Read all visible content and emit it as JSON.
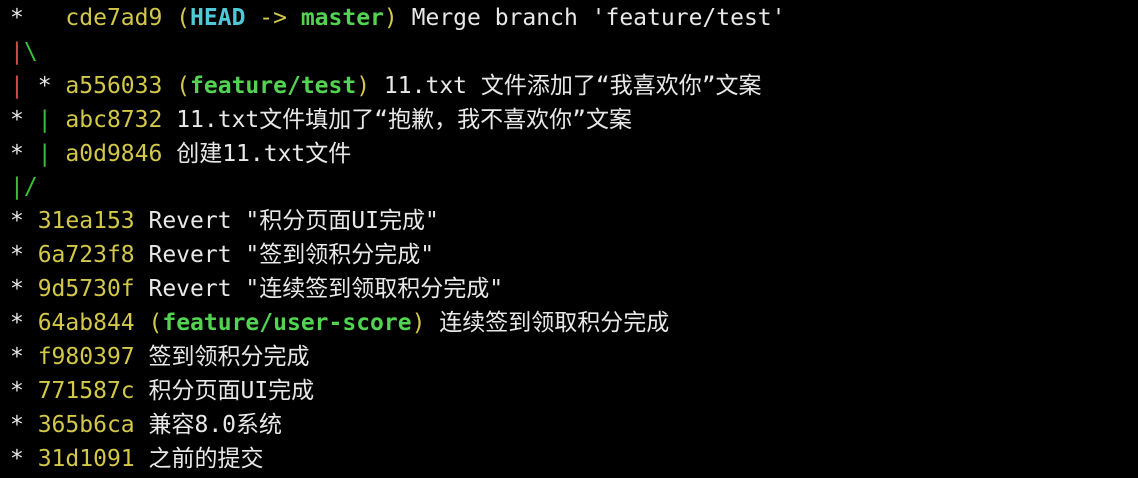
{
  "terminal": {
    "line_count": 14
  },
  "log": {
    "line0": {
      "star": "*",
      "pad": "   ",
      "hash": "cde7ad9",
      "open": " (",
      "head": "HEAD",
      "arrow": " -> ",
      "branch": "master",
      "close": ")",
      "message": " Merge branch 'feature/test'"
    },
    "line1": {
      "bar": "|",
      "slash": "\\"
    },
    "line2": {
      "bar": "|",
      "star": " * ",
      "hash": "a556033",
      "open": " (",
      "branch": "feature/test",
      "close": ")",
      "message": " 11.txt 文件添加了“我喜欢你”文案"
    },
    "line3": {
      "star": "* ",
      "bar": "|",
      "hash": " abc8732",
      "message": " 11.txt文件填加了“抱歉，我不喜欢你”文案"
    },
    "line4": {
      "star": "* ",
      "bar": "|",
      "hash": " a0d9846",
      "message": " 创建11.txt文件"
    },
    "line5": {
      "bar": "|",
      "slash": "/"
    },
    "line6": {
      "star": "* ",
      "hash": "31ea153",
      "message": " Revert \"积分页面UI完成\""
    },
    "line7": {
      "star": "* ",
      "hash": "6a723f8",
      "message": " Revert \"签到领积分完成\""
    },
    "line8": {
      "star": "* ",
      "hash": "9d5730f",
      "message": " Revert \"连续签到领取积分完成\""
    },
    "line9": {
      "star": "* ",
      "hash": "64ab844",
      "open": " (",
      "branch": "feature/user-score",
      "close": ")",
      "message": " 连续签到领取积分完成"
    },
    "line10": {
      "star": "* ",
      "hash": "f980397",
      "message": " 签到领积分完成"
    },
    "line11": {
      "star": "* ",
      "hash": "771587c",
      "message": " 积分页面UI完成"
    },
    "line12": {
      "star": "* ",
      "hash": "365b6ca",
      "message": " 兼容8.0系统"
    },
    "line13": {
      "star": "* ",
      "hash": "31d1091",
      "message": " 之前的提交"
    }
  },
  "colors": {
    "background": "#000000",
    "text": "#e8e8e8",
    "hash": "#d3c84a",
    "head": "#4fc8d8",
    "branch": "#52d452",
    "graph_red": "#d04a4a",
    "graph_green": "#38c038"
  }
}
